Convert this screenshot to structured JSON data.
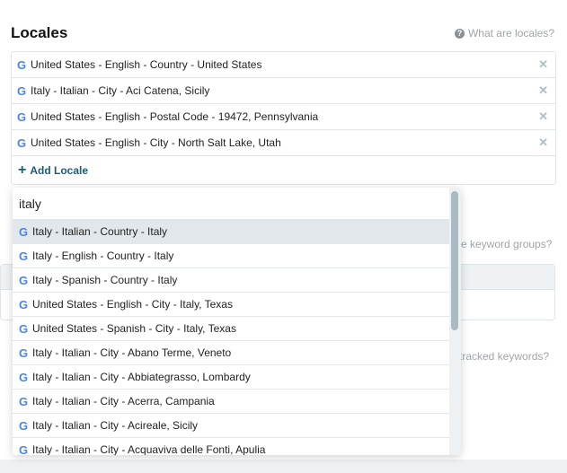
{
  "section": {
    "title": "Locales",
    "help_text": "What are locales?"
  },
  "locales": [
    "United States - English - Country - United States",
    "Italy - Italian - City - Aci Catena, Sicily",
    "United States - English - Postal Code - 19472, Pennsylvania",
    "United States - English - City - North Salt Lake, Utah"
  ],
  "add_locale_label": "Add Locale",
  "background_hints": {
    "keyword_groups": "e keyword groups?",
    "tracked_keywords": "tracked keywords?"
  },
  "search": {
    "value": "italy"
  },
  "options": [
    "Italy - Italian - Country - Italy",
    "Italy - English - Country - Italy",
    "Italy - Spanish - Country - Italy",
    "United States - English - City - Italy, Texas",
    "United States - Spanish - City - Italy, Texas",
    "Italy - Italian - City - Abano Terme, Veneto",
    "Italy - Italian - City - Abbiategrasso, Lombardy",
    "Italy - Italian - City - Acerra, Campania",
    "Italy - Italian - City - Acireale, Sicily",
    "Italy - Italian - City - Acquaviva delle Fonti, Apulia"
  ],
  "icons": {
    "engine": "google-g-icon",
    "remove": "close-icon",
    "help": "question-circle-icon",
    "add": "plus-icon"
  },
  "colors": {
    "google_blue": "#4a86e8",
    "accent": "#1f5c73",
    "selected_bg": "#e1e7ea"
  }
}
